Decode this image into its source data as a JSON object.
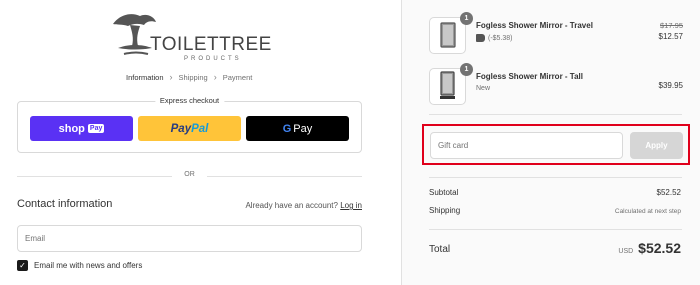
{
  "brand": {
    "name": "TOILETTREE",
    "sub": "PRODUCTS",
    "trademark": "™"
  },
  "breadcrumb": {
    "items": [
      "Information",
      "Shipping",
      "Payment"
    ],
    "current_index": 0
  },
  "express": {
    "label": "Express checkout",
    "shop_pay": {
      "text": "shop",
      "badge": "Pay"
    },
    "paypal": {
      "part1": "Pay",
      "part2": "Pal"
    },
    "gpay": {
      "g": "G",
      "text": "Pay"
    }
  },
  "divider_text": "OR",
  "contact": {
    "title": "Contact information",
    "account_prompt": "Already have an account?",
    "login_label": "Log in",
    "email_placeholder": "Email",
    "email_value": "",
    "newsletter_label": "Email me with news and offers",
    "newsletter_checked": true
  },
  "cart": {
    "items": [
      {
        "name": "Fogless Shower Mirror - Travel",
        "quantity": "1",
        "discount": "(-$5.38)",
        "original_price": "$17.95",
        "price": "$12.57"
      },
      {
        "name": "Fogless Shower Mirror - Tall",
        "quantity": "1",
        "variant": "New",
        "price": "$39.95"
      }
    ]
  },
  "gift_card": {
    "placeholder": "Gift card",
    "value": "",
    "apply_label": "Apply"
  },
  "summary": {
    "subtotal_label": "Subtotal",
    "subtotal_value": "$52.52",
    "shipping_label": "Shipping",
    "shipping_value": "Calculated at next step",
    "total_label": "Total",
    "currency": "USD",
    "total_value": "$52.52"
  },
  "colors": {
    "shop_pay": "#5a31f4",
    "paypal": "#ffc439",
    "gpay": "#000000",
    "highlight": "#e0001b",
    "apply_disabled": "#d6d6d6"
  }
}
